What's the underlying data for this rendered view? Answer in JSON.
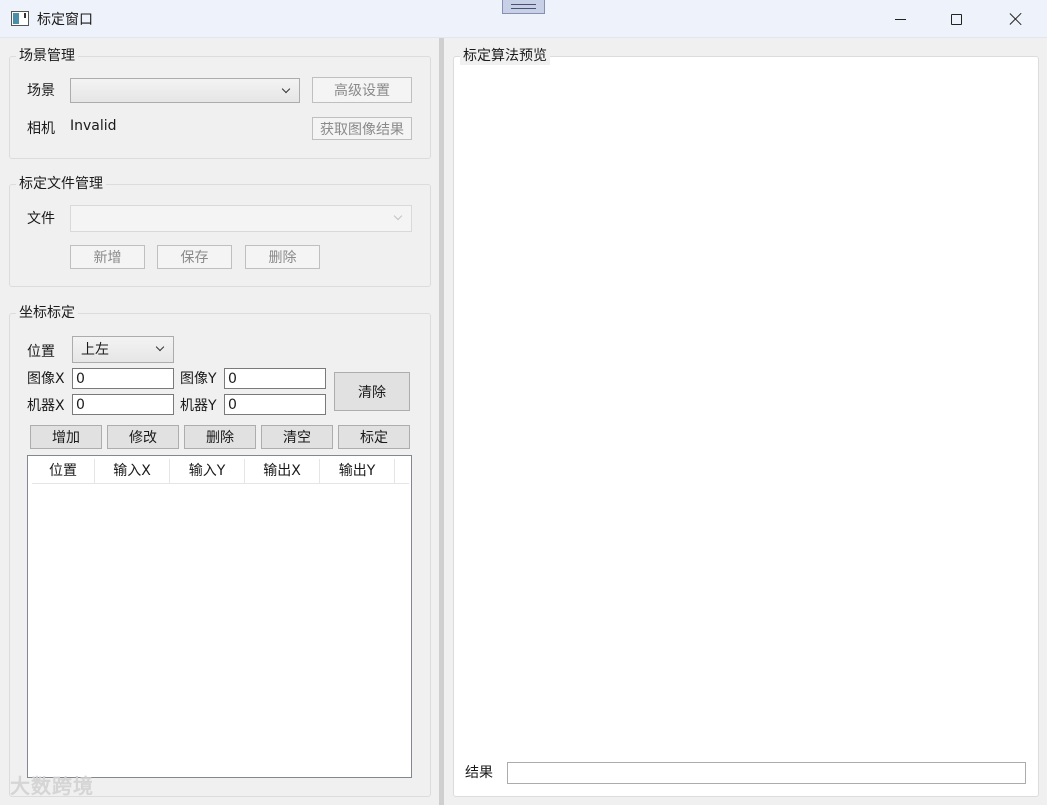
{
  "window": {
    "title": "标定窗口"
  },
  "scene_group": {
    "legend": "场景管理",
    "scene_label": "场景",
    "scene_value": "",
    "advanced_button": "高级设置",
    "camera_label": "相机",
    "camera_value": "Invalid",
    "fetch_button": "获取图像结果"
  },
  "file_group": {
    "legend": "标定文件管理",
    "file_label": "文件",
    "file_value": "",
    "add_button": "新增",
    "save_button": "保存",
    "delete_button": "删除"
  },
  "coord_group": {
    "legend": "坐标标定",
    "position_label": "位置",
    "position_value": "上左",
    "image_x_label": "图像X",
    "image_x_value": "0",
    "image_y_label": "图像Y",
    "image_y_value": "0",
    "machine_x_label": "机器X",
    "machine_x_value": "0",
    "machine_y_label": "机器Y",
    "machine_y_value": "0",
    "clear_button": "清除",
    "actions": {
      "add": "增加",
      "modify": "修改",
      "delete": "删除",
      "clear_all": "清空",
      "calibrate": "标定"
    },
    "table": {
      "columns": [
        "位置",
        "输入X",
        "输入Y",
        "输出X",
        "输出Y"
      ],
      "rows": []
    }
  },
  "preview": {
    "legend": "标定算法预览",
    "result_label": "结果",
    "result_value": ""
  },
  "watermark": "大数跨境",
  "icons": [
    "app-icon",
    "minimize-icon",
    "maximize-icon",
    "close-icon",
    "chevron-down-icon",
    "grip-icon"
  ]
}
